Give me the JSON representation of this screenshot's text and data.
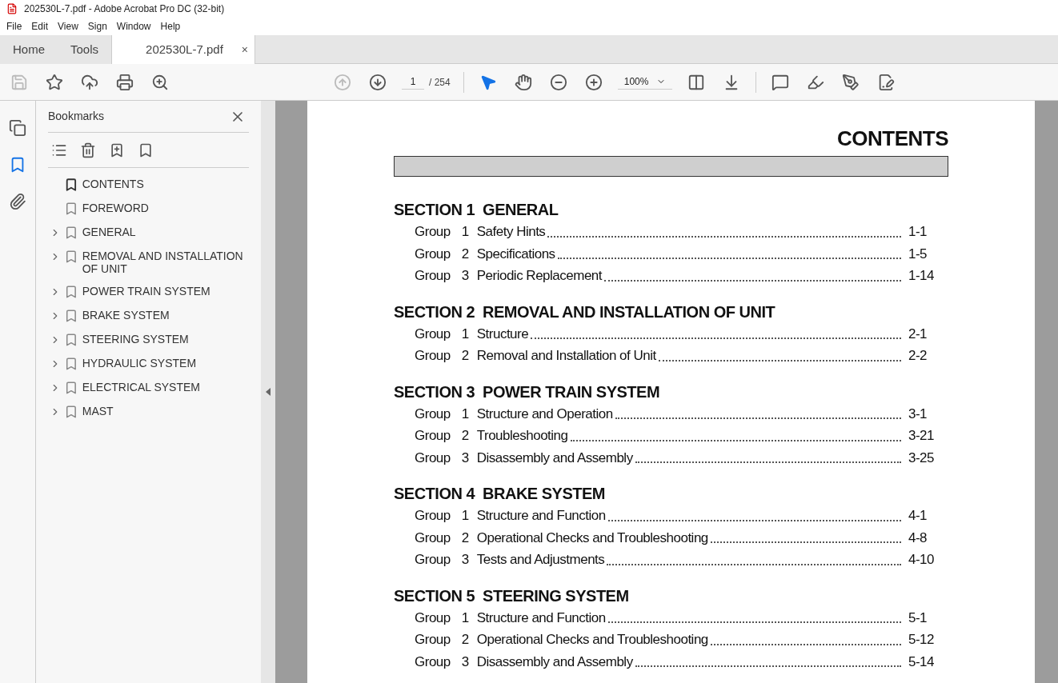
{
  "window": {
    "title": "202530L-7.pdf - Adobe Acrobat Pro DC (32-bit)"
  },
  "menu": [
    "File",
    "Edit",
    "View",
    "Sign",
    "Window",
    "Help"
  ],
  "tabs": [
    {
      "label": "Home",
      "selected": false,
      "kind": "nav"
    },
    {
      "label": "Tools",
      "selected": false,
      "kind": "nav"
    },
    {
      "label": "202530L-7.pdf",
      "selected": true,
      "kind": "doc",
      "close": "×"
    }
  ],
  "toolbar": {
    "page": "1",
    "page_total": "/ 254",
    "zoom": "100%"
  },
  "sidebar": {
    "title": "Bookmarks",
    "items": [
      {
        "label": "CONTENTS",
        "kind": "leaf",
        "selected": true
      },
      {
        "label": "FOREWORD",
        "kind": "leaf",
        "selected": false
      },
      {
        "label": "GENERAL",
        "kind": "group",
        "selected": false
      },
      {
        "label": "REMOVAL AND INSTALLATION OF UNIT",
        "kind": "group",
        "selected": false
      },
      {
        "label": "POWER TRAIN SYSTEM",
        "kind": "group",
        "selected": false
      },
      {
        "label": "BRAKE SYSTEM",
        "kind": "group",
        "selected": false
      },
      {
        "label": "STEERING SYSTEM",
        "kind": "group",
        "selected": false
      },
      {
        "label": "HYDRAULIC SYSTEM",
        "kind": "group",
        "selected": false
      },
      {
        "label": "ELECTRICAL SYSTEM",
        "kind": "group",
        "selected": false
      },
      {
        "label": "MAST",
        "kind": "group",
        "selected": false
      }
    ]
  },
  "document": {
    "title": "CONTENTS",
    "sections": [
      {
        "label": "SECTION 1",
        "title": "GENERAL",
        "groups": [
          {
            "group": "Group",
            "num": "1",
            "title": "Safety Hints",
            "page": "1-1"
          },
          {
            "group": "Group",
            "num": "2",
            "title": "Specifications",
            "page": "1-5"
          },
          {
            "group": "Group",
            "num": "3",
            "title": "Periodic Replacement",
            "page": "1-14"
          }
        ]
      },
      {
        "label": "SECTION 2",
        "title": "REMOVAL AND INSTALLATION OF UNIT",
        "groups": [
          {
            "group": "Group",
            "num": "1",
            "title": "Structure",
            "page": "2-1"
          },
          {
            "group": "Group",
            "num": "2",
            "title": "Removal and Installation of Unit",
            "page": "2-2"
          }
        ]
      },
      {
        "label": "SECTION 3",
        "title": "POWER TRAIN SYSTEM",
        "groups": [
          {
            "group": "Group",
            "num": "1",
            "title": "Structure and Operation",
            "page": "3-1"
          },
          {
            "group": "Group",
            "num": "2",
            "title": "Troubleshooting",
            "page": "3-21"
          },
          {
            "group": "Group",
            "num": "3",
            "title": "Disassembly and Assembly",
            "page": "3-25"
          }
        ]
      },
      {
        "label": "SECTION 4",
        "title": "BRAKE SYSTEM",
        "groups": [
          {
            "group": "Group",
            "num": "1",
            "title": "Structure and Function",
            "page": "4-1"
          },
          {
            "group": "Group",
            "num": "2",
            "title": "Operational Checks and Troubleshooting",
            "page": "4-8"
          },
          {
            "group": "Group",
            "num": "3",
            "title": "Tests and Adjustments",
            "page": "4-10"
          }
        ]
      },
      {
        "label": "SECTION 5",
        "title": "STEERING SYSTEM",
        "groups": [
          {
            "group": "Group",
            "num": "1",
            "title": "Structure and Function",
            "page": "5-1"
          },
          {
            "group": "Group",
            "num": "2",
            "title": "Operational Checks and Troubleshooting",
            "page": "5-12"
          },
          {
            "group": "Group",
            "num": "3",
            "title": "Disassembly and Assembly",
            "page": "5-14"
          }
        ]
      }
    ]
  }
}
